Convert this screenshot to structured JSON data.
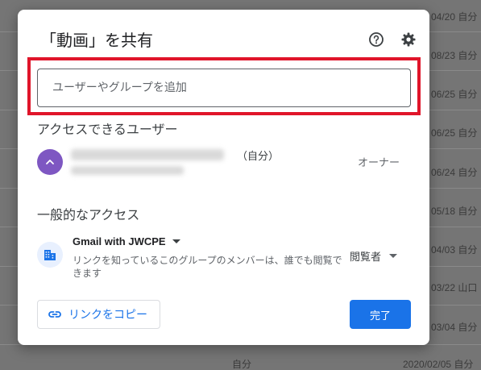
{
  "dialog": {
    "title": "「動画」を共有",
    "help_icon": "help-circle-icon",
    "settings_icon": "gear-icon",
    "add_people_placeholder": "ユーザーやグループを追加",
    "people_section_title": "アクセスできるユーザー",
    "owner": {
      "avatar_icon": "chevron-up-icon",
      "avatar_color": "#7e57c2",
      "self_label": "（自分）",
      "role": "オーナー"
    },
    "general_access": {
      "section_title": "一般的なアクセス",
      "org_icon": "building-icon",
      "group_name": "Gmail with JWCPE",
      "description": "リンクを知っているこのグループのメンバーは、誰でも閲覧できます",
      "role": "閲覧者"
    },
    "copy_link_icon": "link-icon",
    "copy_link_label": "リンクをコピー",
    "done_label": "完了",
    "accent_color": "#1a73e8",
    "highlight_color": "#e0152a"
  },
  "background": {
    "right_column": [
      "04/20 自分",
      "08/23 自分",
      "06/25 自分",
      "06/25 自分",
      "06/24 自分",
      "05/18 自分",
      "04/03 自分",
      "03/22 山口",
      "03/04 自分"
    ],
    "bottom_row": {
      "owner": "自分",
      "date": "2020/02/05 自分"
    }
  }
}
